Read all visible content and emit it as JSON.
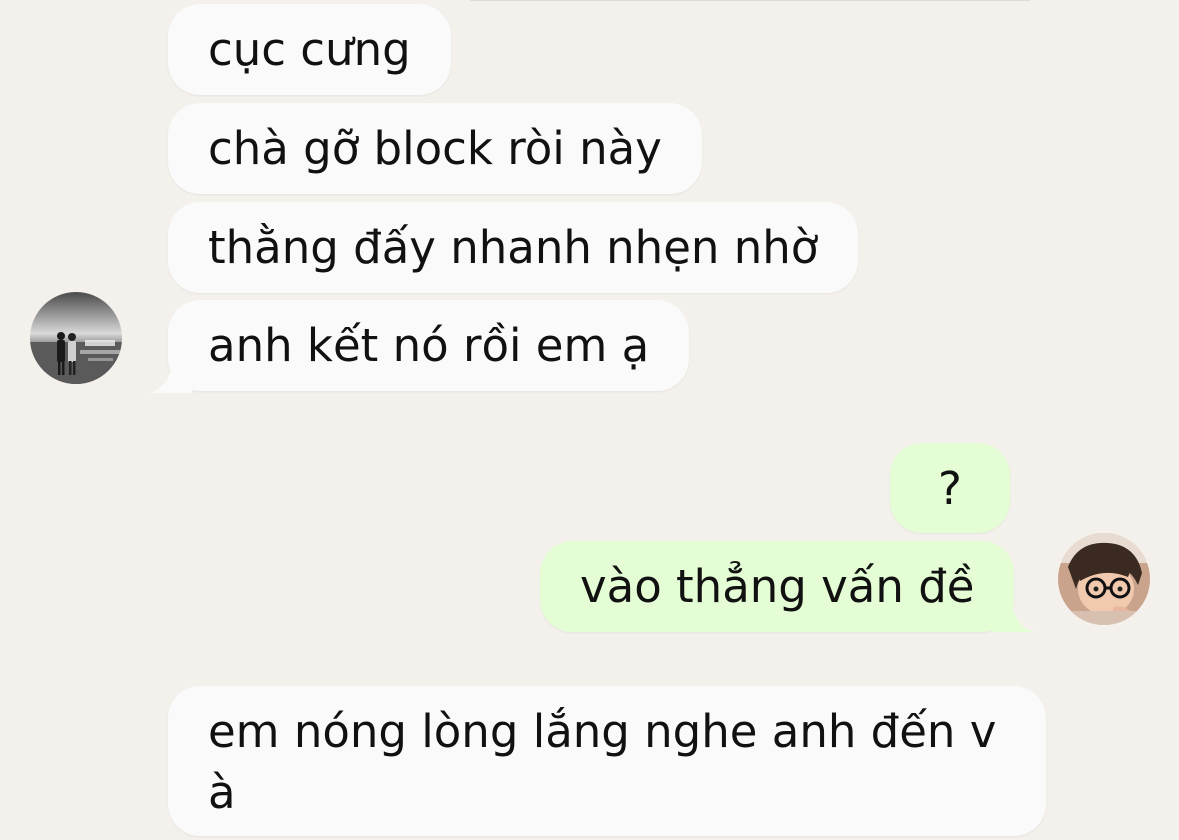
{
  "conversation": {
    "messages": [
      {
        "side": "in",
        "text": "cục cưng"
      },
      {
        "side": "in",
        "text": "chà gỡ block ròi này"
      },
      {
        "side": "in",
        "text": "thằng đấy nhanh nhẹn nhờ"
      },
      {
        "side": "in",
        "text": "anh kết nó rồi em ạ"
      },
      {
        "side": "out",
        "text": "?"
      },
      {
        "side": "out",
        "text": "vào thẳng vấn đề"
      },
      {
        "side": "in",
        "text": "em nóng lòng lắng nghe anh đến v à"
      }
    ]
  },
  "colors": {
    "background": "#f4f1ec",
    "incoming_bubble": "#fafafa",
    "outgoing_bubble": "#e4fdd4",
    "text": "#111111"
  },
  "avatars": {
    "contact": "contact-avatar-icon",
    "self": "self-avatar-icon"
  }
}
